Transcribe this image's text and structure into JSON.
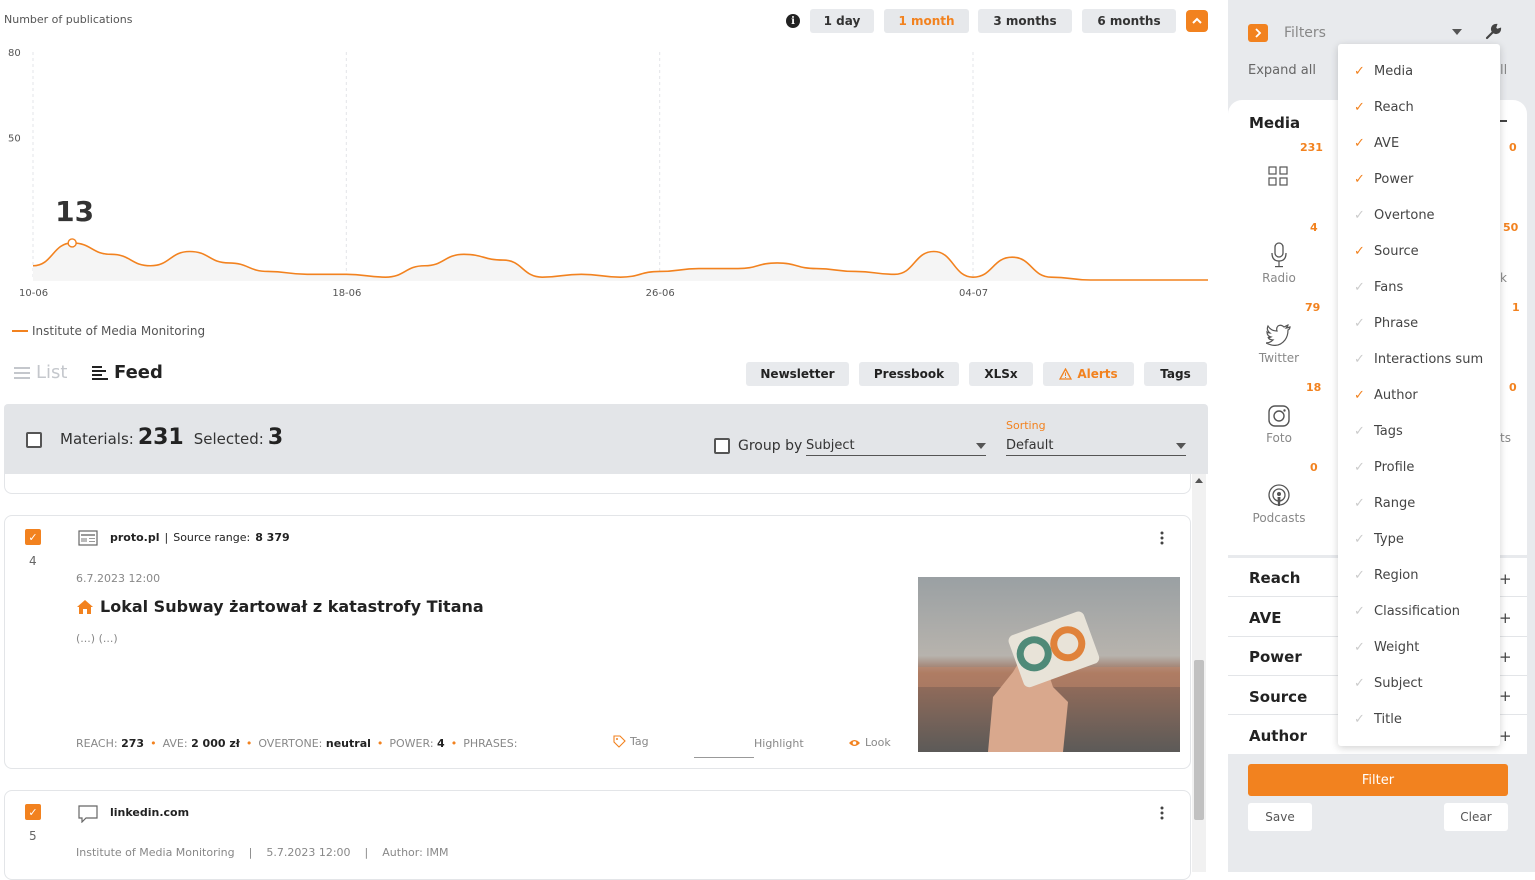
{
  "chart": {
    "ylabel": "Number of publications",
    "periods": [
      "1 day",
      "1 month",
      "3 months",
      "6 months"
    ],
    "active_period": "1 month",
    "highlight_value": "13",
    "legend": "Institute of Media Monitoring"
  },
  "chart_data": {
    "type": "line",
    "xlabel": "",
    "ylabel": "Number of publications",
    "y_ticks": [
      "80",
      "50"
    ],
    "x_ticks": [
      "10-06",
      "18-06",
      "26-06",
      "04-07"
    ],
    "ylim": [
      0,
      80
    ],
    "grid": true,
    "series": [
      {
        "name": "Institute of Media Monitoring",
        "color": "#f2821f",
        "values": [
          5,
          13,
          9,
          5,
          10,
          6,
          3,
          2,
          2,
          1,
          5,
          9,
          7,
          1,
          2,
          1,
          3,
          4,
          4,
          6,
          4,
          3,
          2,
          10,
          1,
          8,
          1,
          0,
          0,
          0,
          0
        ]
      }
    ]
  },
  "list_toolbar": {
    "list_label": "List",
    "feed_label": "Feed",
    "buttons": [
      "Newsletter",
      "Pressbook",
      "XLSx",
      "Alerts",
      "Tags"
    ]
  },
  "materials": {
    "materials_label": "Materials:",
    "materials_count": "231",
    "selected_label": "Selected:",
    "selected_count": "3",
    "group_by_label": "Group by",
    "group_by_value": "Subject",
    "sorting_label": "Sorting",
    "sorting_value": "Default"
  },
  "articles": [
    {
      "number": "4",
      "source": "proto.pl",
      "source_range_label": "Source range:",
      "source_range_value": "8 379",
      "date": "6.7.2023 12:00",
      "title": "Lokal Subway żartował z katastrofy Titana",
      "snippet": "(...) (...)",
      "reach_label": "REACH:",
      "reach_value": "273",
      "ave_label": "AVE:",
      "ave_value": "2 000 zł",
      "overtone_label": "OVERTONE:",
      "overtone_value": "neutral",
      "power_label": "POWER:",
      "power_value": "4",
      "phrases_label": "PHRASES:",
      "tag_label": "Tag",
      "highlight_label": "Highlight",
      "look_label": "Look"
    },
    {
      "number": "5",
      "source": "linkedin.com",
      "author_line": "Institute of Media Monitoring",
      "date": "5.7.2023 12:00",
      "author": "Author: IMM"
    }
  ],
  "filters": {
    "title": "Filters",
    "expand_all": "Expand all",
    "expand_tail": "ll",
    "media_section": "Media",
    "media": [
      {
        "label": "",
        "count": "231",
        "icon": "grid-icon"
      },
      {
        "label": "Radio",
        "count": "4",
        "icon": "microphone-icon"
      },
      {
        "label": "Twitter",
        "count": "79",
        "icon": "twitter-icon"
      },
      {
        "label": "Foto",
        "count": "18",
        "icon": "instagram-icon"
      },
      {
        "label": "Podcasts",
        "count": "0",
        "icon": "podcast-icon"
      }
    ],
    "right_column_counts": [
      "0",
      "50",
      "1",
      "0"
    ],
    "right_column_fragments": [
      "k",
      "ts"
    ],
    "sections": [
      "Reach",
      "AVE",
      "Power",
      "Source",
      "Author"
    ],
    "filter_button": "Filter",
    "save_button": "Save",
    "clear_button": "Clear"
  },
  "dropdown": {
    "items": [
      {
        "label": "Media",
        "checked": true
      },
      {
        "label": "Reach",
        "checked": true
      },
      {
        "label": "AVE",
        "checked": true
      },
      {
        "label": "Power",
        "checked": true
      },
      {
        "label": "Overtone",
        "checked": false
      },
      {
        "label": "Source",
        "checked": true
      },
      {
        "label": "Fans",
        "checked": false
      },
      {
        "label": "Phrase",
        "checked": false
      },
      {
        "label": "Interactions sum",
        "checked": false
      },
      {
        "label": "Author",
        "checked": true
      },
      {
        "label": "Tags",
        "checked": false
      },
      {
        "label": "Profile",
        "checked": false
      },
      {
        "label": "Range",
        "checked": false
      },
      {
        "label": "Type",
        "checked": false
      },
      {
        "label": "Region",
        "checked": false
      },
      {
        "label": "Classification",
        "checked": false
      },
      {
        "label": "Weight",
        "checked": false
      },
      {
        "label": "Subject",
        "checked": false
      },
      {
        "label": "Title",
        "checked": false
      }
    ]
  },
  "colors": {
    "accent": "#f2821f",
    "panel": "#e8eaed"
  }
}
